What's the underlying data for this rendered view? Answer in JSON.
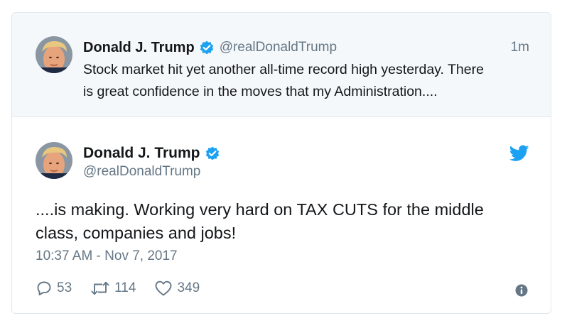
{
  "parent_tweet": {
    "author_name": "Donald J. Trump",
    "handle": "@realDonaldTrump",
    "time_ago": "1m",
    "text_line1": "Stock market hit yet another all-time record high yesterday. There",
    "text_line2": "is great confidence in the moves that my Administration...."
  },
  "main_tweet": {
    "author_name": "Donald J. Trump",
    "handle": "@realDonaldTrump",
    "text_line1": "....is making. Working very hard on TAX CUTS for the middle",
    "text_line2": "class, companies and jobs!",
    "timestamp": "10:37 AM - Nov 7, 2017",
    "replies": "53",
    "retweets": "114",
    "likes": "349"
  },
  "colors": {
    "verified_blue": "#1da1f2",
    "twitter_blue": "#1da1f2",
    "secondary_text": "#657786",
    "parent_background": "#f5f8fa"
  },
  "icons": [
    "verified-badge-icon",
    "twitter-bird-icon",
    "reply-icon",
    "retweet-icon",
    "like-icon",
    "info-icon"
  ]
}
